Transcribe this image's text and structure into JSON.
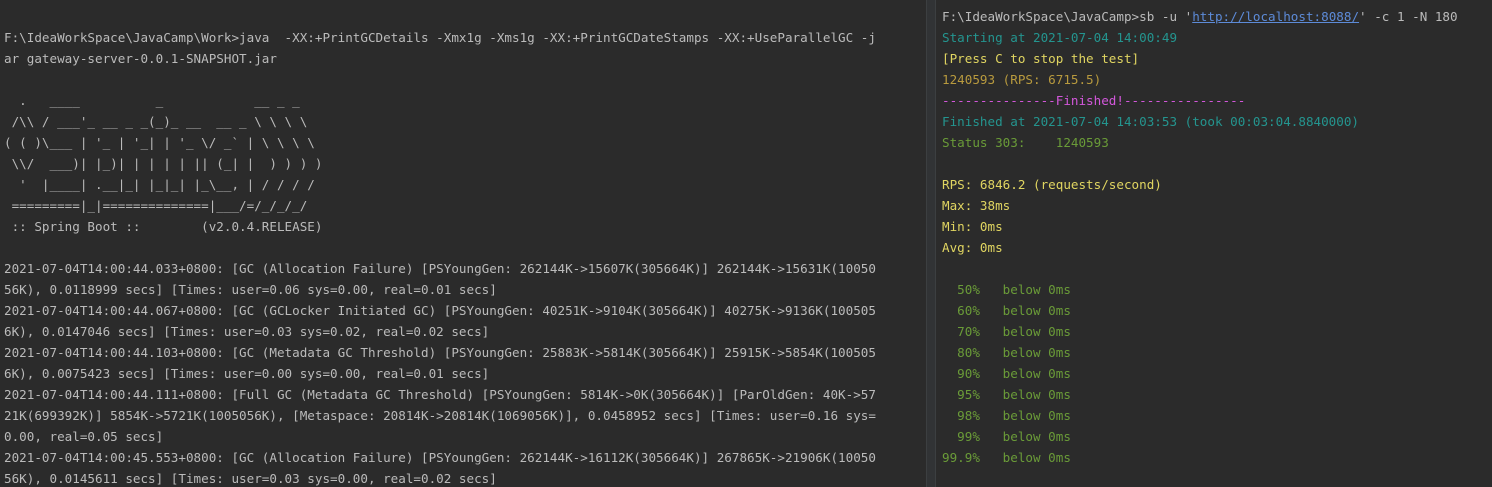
{
  "left_terminal": {
    "cut_top_line": "   ",
    "command_line_1": "F:\\IdeaWorkSpace\\JavaCamp\\Work>java  -XX:+PrintGCDetails -Xmx1g -Xms1g -XX:+PrintGCDateStamps -XX:+UseParallelGC -j",
    "command_line_2": "ar gateway-server-0.0.1-SNAPSHOT.jar",
    "banner": [
      "  .   ____          _            __ _ _",
      " /\\\\ / ___'_ __ _ _(_)_ __  __ _ \\ \\ \\ \\",
      "( ( )\\___ | '_ | '_| | '_ \\/ _` | \\ \\ \\ \\",
      " \\\\/  ___)| |_)| | | | | || (_| |  ) ) ) )",
      "  '  |____| .__|_| |_|_| |_\\__, | / / / /",
      " =========|_|==============|___/=/_/_/_/",
      " :: Spring Boot ::        (v2.0.4.RELEASE)"
    ],
    "gc_lines": [
      "2021-07-04T14:00:44.033+0800: [GC (Allocation Failure) [PSYoungGen: 262144K->15607K(305664K)] 262144K->15631K(10050",
      "56K), 0.0118999 secs] [Times: user=0.06 sys=0.00, real=0.01 secs]",
      "2021-07-04T14:00:44.067+0800: [GC (GCLocker Initiated GC) [PSYoungGen: 40251K->9104K(305664K)] 40275K->9136K(100505",
      "6K), 0.0147046 secs] [Times: user=0.03 sys=0.02, real=0.02 secs]",
      "2021-07-04T14:00:44.103+0800: [GC (Metadata GC Threshold) [PSYoungGen: 25883K->5814K(305664K)] 25915K->5854K(100505",
      "6K), 0.0075423 secs] [Times: user=0.00 sys=0.00, real=0.01 secs]",
      "2021-07-04T14:00:44.111+0800: [Full GC (Metadata GC Threshold) [PSYoungGen: 5814K->0K(305664K)] [ParOldGen: 40K->57",
      "21K(699392K)] 5854K->5721K(1005056K), [Metaspace: 20814K->20814K(1069056K)], 0.0458952 secs] [Times: user=0.16 sys=",
      "0.00, real=0.05 secs]",
      "2021-07-04T14:00:45.553+0800: [GC (Allocation Failure) [PSYoungGen: 262144K->16112K(305664K)] 267865K->21906K(10050",
      "56K), 0.0145611 secs] [Times: user=0.03 sys=0.00, real=0.02 secs]"
    ]
  },
  "right_terminal": {
    "prompt_prefix": "F:\\IdeaWorkSpace\\JavaCamp>sb -u '",
    "prompt_url": "http://localhost:8088/",
    "prompt_suffix": "' -c 1 -N 180",
    "starting": "Starting at 2021-07-04 14:00:49",
    "press_c": "[Press C to stop the test]",
    "progress": "1240593 (RPS: 6715.5)",
    "finished_banner": "---------------Finished!----------------",
    "finished_at": "Finished at 2021-07-04 14:03:53 (took 00:03:04.8840000)",
    "status": "Status 303:    1240593",
    "rps": "RPS: 6846.2 (requests/second)",
    "max": "Max: 38ms",
    "min": "Min: 0ms",
    "avg": "Avg: 0ms",
    "percentiles": [
      {
        "pct": "  50%",
        "text": "   below 0ms"
      },
      {
        "pct": "  60%",
        "text": "   below 0ms"
      },
      {
        "pct": "  70%",
        "text": "   below 0ms"
      },
      {
        "pct": "  80%",
        "text": "   below 0ms"
      },
      {
        "pct": "  90%",
        "text": "   below 0ms"
      },
      {
        "pct": "  95%",
        "text": "   below 0ms"
      },
      {
        "pct": "  98%",
        "text": "   below 0ms"
      },
      {
        "pct": "  99%",
        "text": "   below 0ms"
      },
      {
        "pct": "99.9%",
        "text": "   below 0ms"
      }
    ]
  },
  "colors": {
    "background": "#2b2b2b",
    "default_text": "#bbbbbb",
    "cyan": "#24958f",
    "yellow": "#e0d561",
    "orange": "#b89a3e",
    "magenta": "#d357db",
    "green": "#6a9b38",
    "link": "#5d8bd8"
  }
}
